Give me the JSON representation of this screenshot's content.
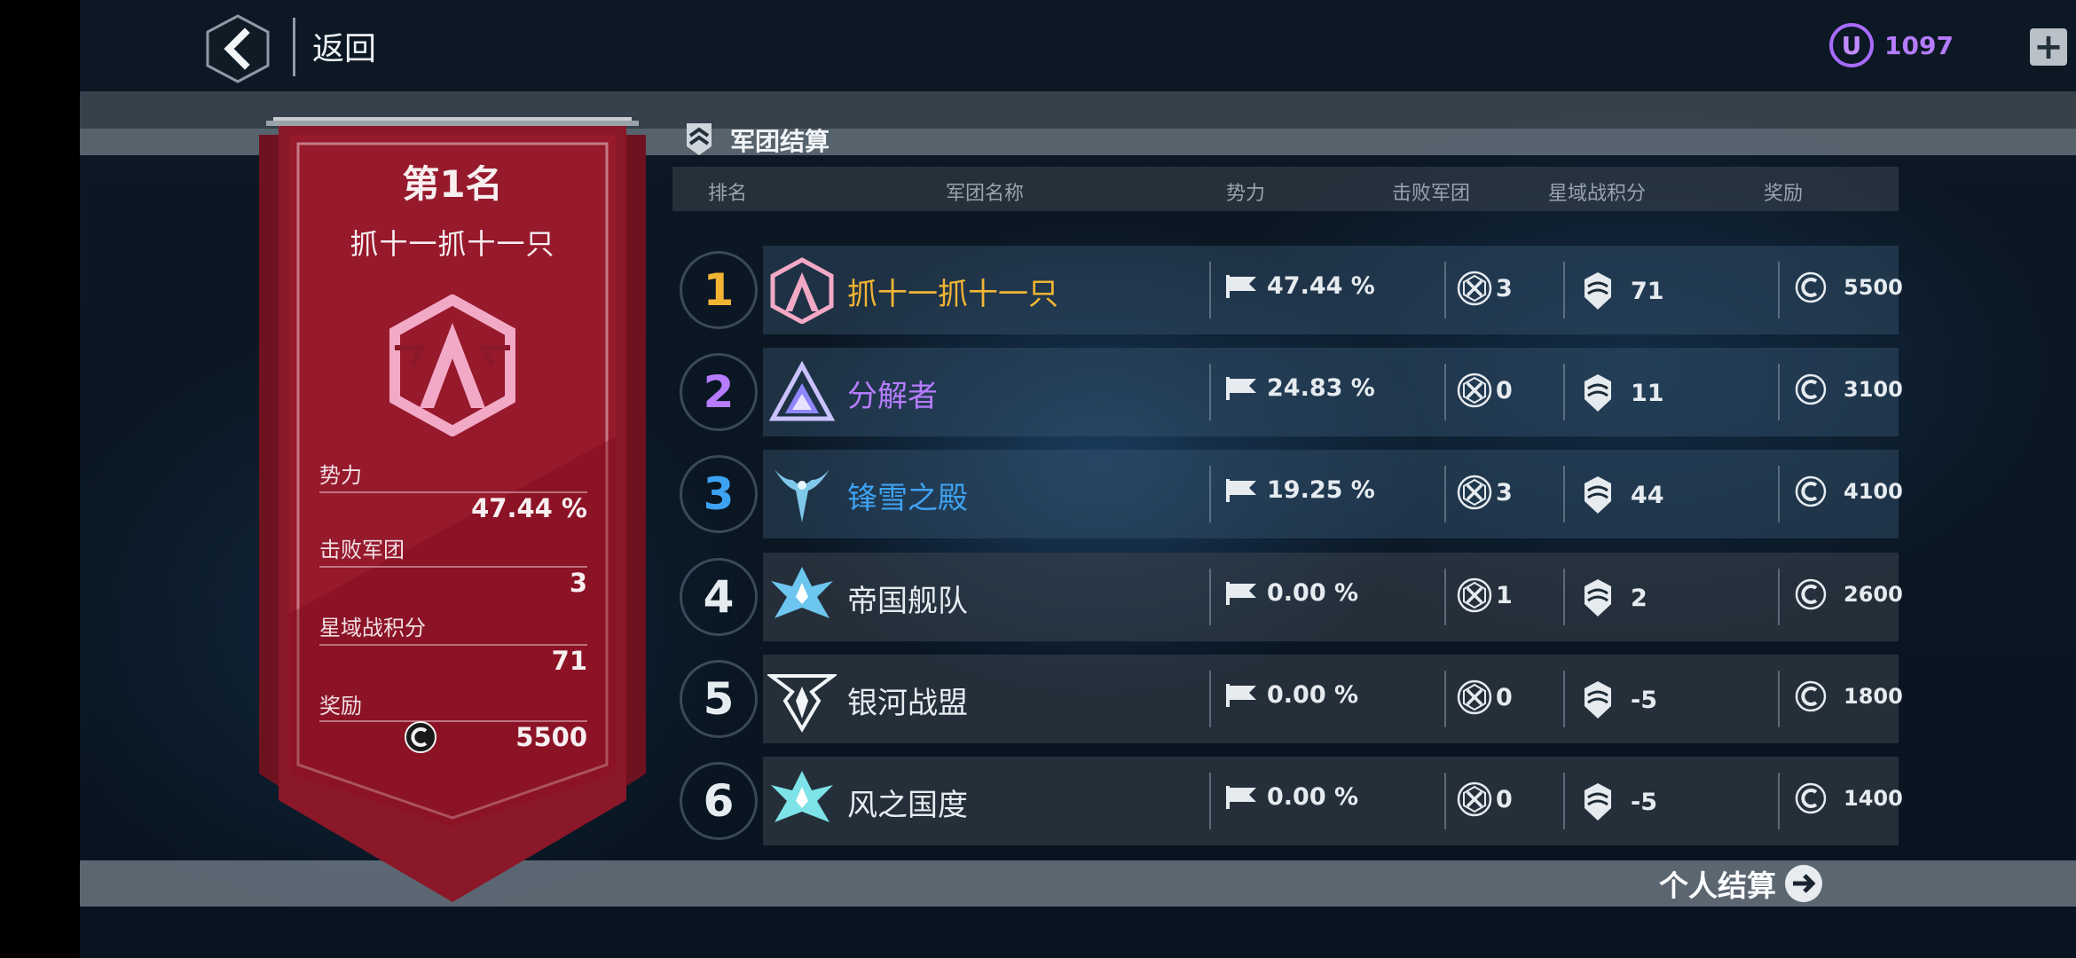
{
  "header": {
    "back_label": "返回",
    "currency_symbol": "U",
    "currency_value": "1097",
    "plus_label": "+"
  },
  "section_title": "军团结算",
  "table": {
    "headers": [
      "排名",
      "军团名称",
      "势力",
      "击败军团",
      "星域战积分",
      "奖励"
    ],
    "rows": [
      {
        "rank": "1",
        "name": "抓十一抓十一只",
        "power": "47.44 %",
        "defeated": "3",
        "score": "71",
        "reward": "5500",
        "name_color": "#f2b533",
        "rank_color": "#f2b533",
        "icon": "chevron-hex-emblem-icon"
      },
      {
        "rank": "2",
        "name": "分解者",
        "power": "24.83 %",
        "defeated": "0",
        "score": "11",
        "reward": "3100",
        "name_color": "#b67cff",
        "rank_color": "#b67cff",
        "icon": "triangle-emblem-icon"
      },
      {
        "rank": "3",
        "name": "锋雪之殿",
        "power": "19.25 %",
        "defeated": "3",
        "score": "44",
        "reward": "4100",
        "name_color": "#3ea2f2",
        "rank_color": "#3ea2f2",
        "icon": "horned-emblem-icon"
      },
      {
        "rank": "4",
        "name": "帝国舰队",
        "power": "0.00 %",
        "defeated": "1",
        "score": "2",
        "reward": "2600",
        "name_color": "#e6ebf0",
        "rank_color": "#e6ebf0",
        "icon": "fleet-emblem-icon"
      },
      {
        "rank": "5",
        "name": "银河战盟",
        "power": "0.00 %",
        "defeated": "0",
        "score": "-5",
        "reward": "1800",
        "name_color": "#e6ebf0",
        "rank_color": "#e6ebf0",
        "icon": "winged-emblem-icon"
      },
      {
        "rank": "6",
        "name": "风之国度",
        "power": "0.00 %",
        "defeated": "0",
        "score": "-5",
        "reward": "1400",
        "name_color": "#e6ebf0",
        "rank_color": "#e6ebf0",
        "icon": "wind-emblem-icon"
      }
    ]
  },
  "banner": {
    "title": "第1名",
    "legion_name": "抓十一抓十一只",
    "power_label": "势力",
    "power_value": "47.44 %",
    "defeated_label": "击败军团",
    "defeated_value": "3",
    "score_label": "星域战积分",
    "score_value": "71",
    "reward_label": "奖励",
    "reward_value": "5500"
  },
  "footer": {
    "personal_label": "个人结算"
  },
  "colors": {
    "banner_red": "#8e1a2b",
    "currency_purple": "#b57cff"
  }
}
